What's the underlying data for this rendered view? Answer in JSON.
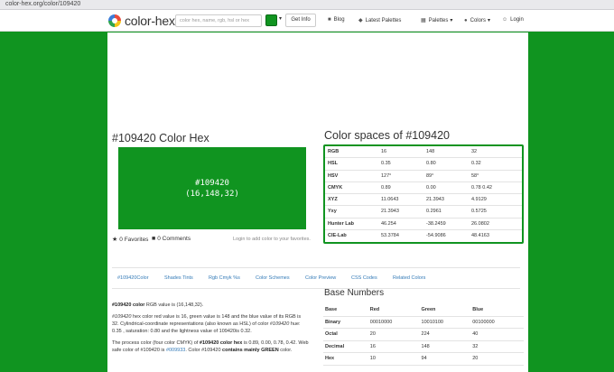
{
  "browser": {
    "url": "color-hex.org/color/109420"
  },
  "nav": {
    "logo": "color-hex",
    "search_placeholder": "color hex, name, rgb, hsl or hex",
    "get_info": "Get Info",
    "blog": "Blog",
    "latest_palettes": "Latest Palettes",
    "palettes": "Palettes",
    "colors": "Colors",
    "login": "Login",
    "swatch_color": "#109420"
  },
  "color": {
    "title": "#109420 Color Hex",
    "hex": "#109420",
    "rgb": "(16,148,32)",
    "favorites": "0 Favorites",
    "comments": "0 Comments",
    "login_note": "Login to add color to your favorites."
  },
  "color_spaces": {
    "title": "Color spaces of #109420",
    "rows": [
      {
        "label": "RGB",
        "values": [
          "16",
          "148",
          "32"
        ]
      },
      {
        "label": "HSL",
        "values": [
          "0.35",
          "0.80",
          "0.32"
        ]
      },
      {
        "label": "HSV",
        "values": [
          "127°",
          "89°",
          "58°"
        ]
      },
      {
        "label": "CMYK",
        "values": [
          "0.89",
          "0.00",
          "0.78   0.42"
        ]
      },
      {
        "label": "XYZ",
        "values": [
          "11.0643",
          "21.3943",
          "4.9129"
        ]
      },
      {
        "label": "Yxy",
        "values": [
          "21.3943",
          "0.2961",
          "0.5725"
        ]
      },
      {
        "label": "Hunter Lab",
        "values": [
          "46.254",
          "-38.2459",
          "26.0802"
        ]
      },
      {
        "label": "CIE-Lab",
        "values": [
          "53.3784",
          "-54.9086",
          "48.4163"
        ]
      }
    ]
  },
  "tabs": [
    "#109420Color",
    "Shades Tints",
    "Rgb Cmyk %s",
    "Color Schemes",
    "Color Preview",
    "CSS Codes",
    "Related Colors"
  ],
  "description": {
    "p1_bold": "#109420 color",
    "p1_rest": " RGB value is (16,148,32).",
    "p2_italic": "#109420",
    "p2_a": " hex color red value is 16, green value is 148 and the blue value of its RGB is 32. Cylindrical-coordinate representations (also known as HSL) of color ",
    "p2_italic2": "#109420",
    "p2_b": " hue: 0.35 , saturation: 0.80 and the lightness value of 109420is 0.32.",
    "p3_a": "The process color (four color CMYK) of ",
    "p3_bold": "#109420 color hex",
    "p3_b": " is 0.89, 0.00, 0.78, 0.42. Web safe color of #109420 is ",
    "p3_link": "#009933",
    "p3_c": ". Color #109420 ",
    "p3_bold2": "contains mainly GREEN",
    "p3_d": " color."
  },
  "base_numbers": {
    "title": "Base Numbers",
    "headers": [
      "Base",
      "Red",
      "Green",
      "Blue"
    ],
    "rows": [
      {
        "label": "Binary",
        "values": [
          "00010000",
          "10010100",
          "00100000"
        ]
      },
      {
        "label": "Octal",
        "values": [
          "20",
          "224",
          "40"
        ]
      },
      {
        "label": "Decimal",
        "values": [
          "16",
          "148",
          "32"
        ]
      },
      {
        "label": "Hex",
        "values": [
          "10",
          "94",
          "20"
        ]
      }
    ]
  }
}
